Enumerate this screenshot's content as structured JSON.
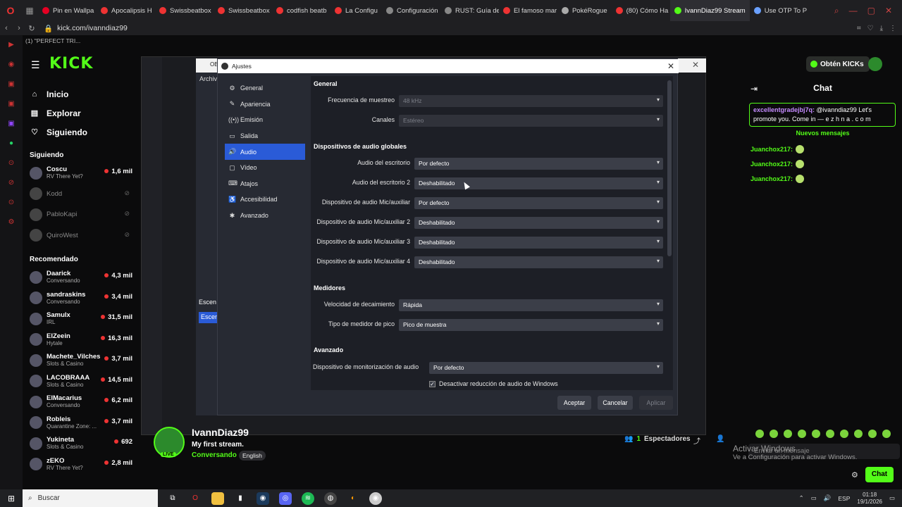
{
  "browser": {
    "tabs": [
      {
        "title": "Pin en Wallpa",
        "color": "#e60023"
      },
      {
        "title": "Apocalipsis H",
        "color": "#e33"
      },
      {
        "title": "Swissbeatbox",
        "color": "#e33"
      },
      {
        "title": "Swissbeatbox",
        "color": "#e33"
      },
      {
        "title": "codfish beatb",
        "color": "#e33"
      },
      {
        "title": "La Configu",
        "color": "#e33"
      },
      {
        "title": "Configuración",
        "color": "#888"
      },
      {
        "title": "RUST: Guía de",
        "color": "#888"
      },
      {
        "title": "El famoso mar",
        "color": "#e33"
      },
      {
        "title": "PokéRogue",
        "color": "#aaa"
      },
      {
        "title": "(80) Cómo Ha",
        "color": "#e33"
      },
      {
        "title": "IvannDiaz99 Stream",
        "color": "#53fc18"
      },
      {
        "title": "Use OTP To P",
        "color": "#6aa0ff"
      }
    ],
    "url": "kick.com/ivanndiaz99",
    "media_line": "(1) \"PERFECT TRI..."
  },
  "kick": {
    "logo": "KICK",
    "obtain_label": "Obtén KICKs",
    "nav": [
      {
        "icon": "⌂",
        "label": "Inicio"
      },
      {
        "icon": "▤",
        "label": "Explorar"
      },
      {
        "icon": "♡",
        "label": "Siguiendo"
      }
    ],
    "following_title": "Siguiendo",
    "following": [
      {
        "name": "Coscu",
        "sub": "RV There Yet?",
        "count": "1,6 mil",
        "online": true
      },
      {
        "name": "Kodd",
        "sub": "",
        "count": "",
        "online": false
      },
      {
        "name": "PabloKapi",
        "sub": "",
        "count": "",
        "online": false
      },
      {
        "name": "QuiroWest",
        "sub": "",
        "count": "",
        "online": false
      }
    ],
    "recommended_title": "Recomendado",
    "recommended": [
      {
        "name": "Daarick",
        "sub": "Conversando",
        "count": "4,3 mil"
      },
      {
        "name": "sandraskins",
        "sub": "Conversando",
        "count": "3,4 mil"
      },
      {
        "name": "Samulx",
        "sub": "IRL",
        "count": "31,5 mil"
      },
      {
        "name": "ElZeein",
        "sub": "Hytale",
        "count": "16,3 mil"
      },
      {
        "name": "Machete_Vilches",
        "sub": "Slots & Casino",
        "count": "3,7 mil"
      },
      {
        "name": "LACOBRAAA",
        "sub": "Slots & Casino",
        "count": "14,5 mil"
      },
      {
        "name": "ElMacarius",
        "sub": "Conversando",
        "count": "6,2 mil"
      },
      {
        "name": "Robleis",
        "sub": "Quarantine Zone: ...",
        "count": "3,7 mil"
      },
      {
        "name": "Yukineta",
        "sub": "Slots & Casino",
        "count": "692"
      },
      {
        "name": "zEKO",
        "sub": "RV There Yet?",
        "count": "2,8 mil"
      }
    ],
    "stream": {
      "name": "IvannDiaz99",
      "title": "My first stream.",
      "category": "Conversando",
      "language": "English",
      "live": "LIVE",
      "viewers_count": "1",
      "viewers_label": "Espectadores"
    },
    "chat": {
      "title": "Chat",
      "pinned_user": "excellentgradejbj7q:",
      "pinned_text": "@ivanndiaz99 Let's promote you. Come in — e z h n a . c o m",
      "new_messages": "Nuevos mensajes",
      "messages": [
        {
          "user": "Juanchox217:"
        },
        {
          "user": "Juanchox217:"
        },
        {
          "user": "Juanchox217:"
        }
      ],
      "input_placeholder": "Enviar un mensaje",
      "send_label": "Chat"
    },
    "windows_activation": {
      "line1": "Activar Windows",
      "line2": "Ve a Configuración para activar Windows."
    }
  },
  "obs_back": {
    "title": "OB",
    "menu": "Archiv",
    "scenes": "Escen",
    "scene_item": "Escen"
  },
  "settings": {
    "window_title": "Ajustes",
    "sidebar": [
      {
        "icon": "⚙",
        "label": "General"
      },
      {
        "icon": "✎",
        "label": "Apariencia"
      },
      {
        "icon": "((•))",
        "label": "Emisión"
      },
      {
        "icon": "▭",
        "label": "Salida"
      },
      {
        "icon": "🔊",
        "label": "Audio"
      },
      {
        "icon": "▢",
        "label": "Vídeo"
      },
      {
        "icon": "⌨",
        "label": "Atajos"
      },
      {
        "icon": "♿",
        "label": "Accesibilidad"
      },
      {
        "icon": "✱",
        "label": "Avanzado"
      }
    ],
    "selected_index": 4,
    "sections": {
      "general": "General",
      "global_devices": "Dispositivos de audio globales",
      "meters": "Medidores",
      "advanced": "Avanzado"
    },
    "general_rows": [
      {
        "label": "Frecuencia de muestreo",
        "value": "48 kHz",
        "disabled": true
      },
      {
        "label": "Canales",
        "value": "Estéreo",
        "disabled": true
      }
    ],
    "device_rows": [
      {
        "label": "Audio del escritorio",
        "value": "Por defecto"
      },
      {
        "label": "Audio del escritorio 2",
        "value": "Deshabilitado"
      },
      {
        "label": "Dispositivo de audio Mic/auxiliar",
        "value": "Por defecto"
      },
      {
        "label": "Dispositivo de audio Mic/auxiliar 2",
        "value": "Deshabilitado"
      },
      {
        "label": "Dispositivo de audio Mic/auxiliar 3",
        "value": "Deshabilitado"
      },
      {
        "label": "Dispositivo de audio Mic/auxiliar 4",
        "value": "Deshabilitado"
      }
    ],
    "meter_rows": [
      {
        "label": "Velocidad de decaimiento",
        "value": "Rápida"
      },
      {
        "label": "Tipo de medidor de pico",
        "value": "Pico de muestra"
      }
    ],
    "monitor_row": {
      "label": "Dispositivo de monitorización de audio",
      "value": "Por defecto"
    },
    "ducking_checkbox": {
      "label": "Desactivar reducción de audio de Windows",
      "checked": true
    },
    "buttons": {
      "accept": "Aceptar",
      "cancel": "Cancelar",
      "apply": "Aplicar"
    }
  },
  "taskbar": {
    "search": "Buscar",
    "lang": "ESP",
    "time": "01:18",
    "date": "19/1/2026"
  }
}
